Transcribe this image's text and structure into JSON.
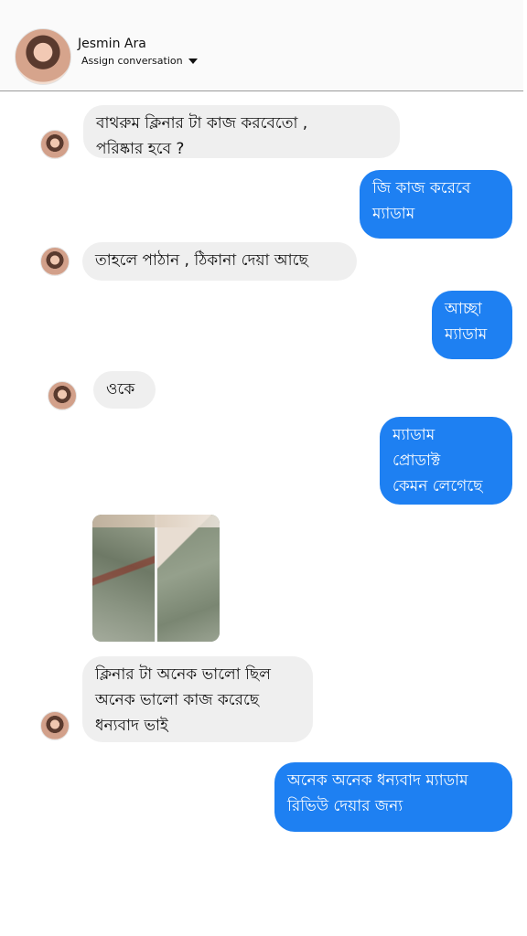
{
  "header": {
    "contact_name": "Jesmin Ara",
    "assign_label": "Assign conversation",
    "assign_icon": "caret-down-icon"
  },
  "messages": [
    {
      "side": "in",
      "text": "বাথরুম ক্লিনার টা কাজ করবেতো ,\nপরিষ্কার হবে ?"
    },
    {
      "side": "out",
      "text": "জি কাজ করেবে\nম্যাডাম"
    },
    {
      "side": "in",
      "text": "তাহলে পাঠান , ঠিকানা দেয়া আছে"
    },
    {
      "side": "out",
      "text": "আচ্ছা\nম্যাডাম"
    },
    {
      "side": "in",
      "text": "ওকে"
    },
    {
      "side": "out",
      "text": "ম্যাডাম\nপ্রোডাক্ট\nকেমন লেগেছে"
    },
    {
      "side": "in",
      "type": "image",
      "text": ""
    },
    {
      "side": "in",
      "text": "ক্লিনার টা অনেক ভালো ছিল\nঅনেক ভালো কাজ করেছে\nধন্যবাদ ভাই"
    },
    {
      "side": "out",
      "text": "অনেক অনেক ধন্যবাদ ম্যাডাম\nরিভিউ দেয়ার জন্য"
    }
  ],
  "colors": {
    "outgoing_bubble": "#1e80f2",
    "incoming_bubble": "#efefef",
    "header_bg": "#fafafa"
  }
}
